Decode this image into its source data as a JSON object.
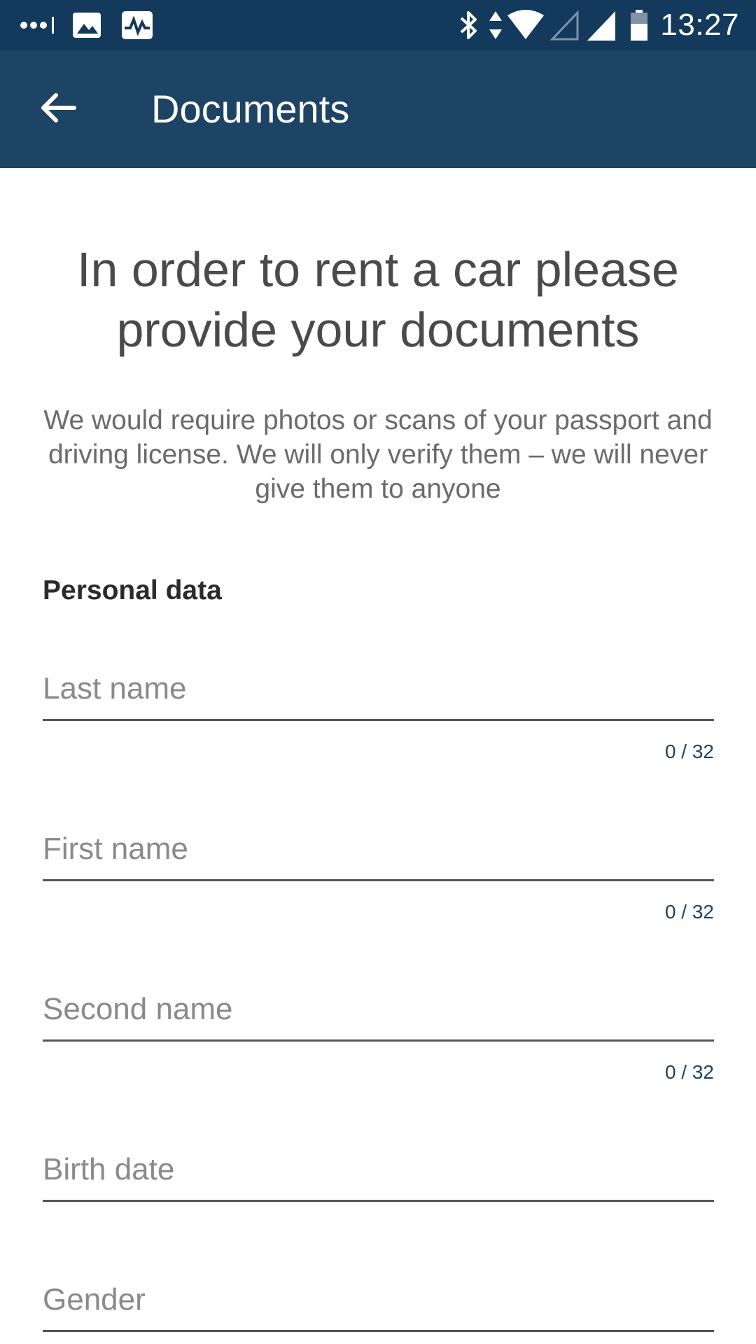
{
  "status_bar": {
    "time": "13:27",
    "icons": [
      "dots-icon",
      "image-icon",
      "activity-icon",
      "bluetooth-icon",
      "data-arrows-icon",
      "wifi-icon",
      "signal-empty-icon",
      "signal-icon",
      "battery-icon"
    ],
    "background": "#133a5c"
  },
  "app_bar": {
    "title": "Documents",
    "back_icon": "arrow-back-icon",
    "background": "#1d4365"
  },
  "main": {
    "heading": "In order to rent a car please provide your documents",
    "subtext": "We would require photos or scans of your passport and driving license. We will only verify them – we will never give them to anyone",
    "section_title": "Personal data"
  },
  "fields": {
    "last_name": {
      "placeholder": "Last name",
      "value": "",
      "counter": "0 / 32"
    },
    "first_name": {
      "placeholder": "First name",
      "value": "",
      "counter": "0 / 32"
    },
    "second_name": {
      "placeholder": "Second name",
      "value": "",
      "counter": "0 / 32"
    },
    "birth_date": {
      "placeholder": "Birth date",
      "value": ""
    },
    "gender": {
      "placeholder": "Gender",
      "value": ""
    }
  },
  "colors": {
    "accent": "#1d4365",
    "text_dark": "#4a4a4a"
  }
}
